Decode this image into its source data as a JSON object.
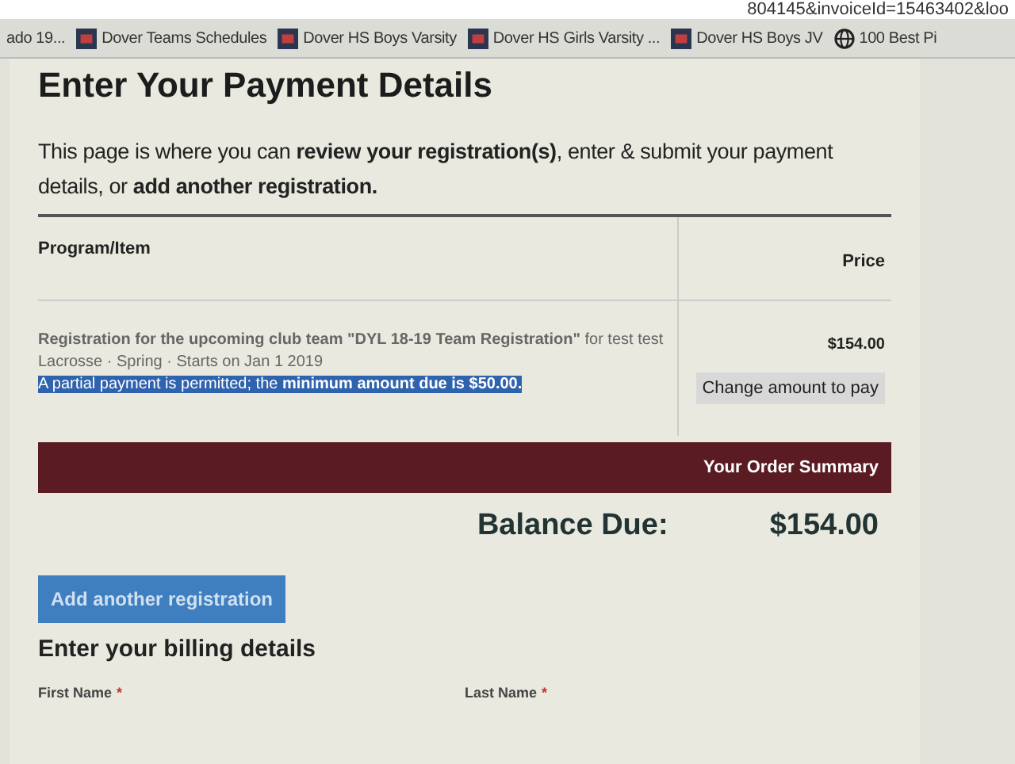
{
  "address_bar": {
    "url": "804145&invoiceId=15463402&loo"
  },
  "bookmarks": [
    {
      "label": "ado 19...",
      "kind": "plain"
    },
    {
      "label": "Dover Teams Schedules",
      "kind": "logo"
    },
    {
      "label": "Dover HS Boys Varsity",
      "kind": "logo"
    },
    {
      "label": "Dover HS Girls Varsity ...",
      "kind": "logo"
    },
    {
      "label": "Dover HS Boys JV",
      "kind": "logo"
    },
    {
      "label": "100 Best Pi",
      "kind": "globe"
    }
  ],
  "heading": "Enter Your Payment Details",
  "intro": "This page is where you can **review your registration(s)**, enter & submit your payment details, or **add another registration.**",
  "table": {
    "columns": [
      "Program/Item",
      "Price"
    ],
    "rows": [
      {
        "title": "**Registration for the upcoming club team \"DYL 18-19 Team Registration\"** for test test",
        "meta": "Lacrosse · Spring · Starts on Jan 1 2019",
        "note": "A partial payment is permitted; the **minimum amount due is $50.00.**",
        "note_highlighted": true,
        "price": "$154.00",
        "action": "Change amount to pay"
      }
    ]
  },
  "summary": {
    "title": "Your Order Summary",
    "balance_label": "Balance Due:",
    "balance": "$154.00"
  },
  "add_button": "Add another registration",
  "billing": {
    "heading": "Enter your billing details",
    "fields": [
      {
        "label": "First Name",
        "mark": "*"
      },
      {
        "label": "Last Name",
        "mark": "*"
      }
    ]
  }
}
